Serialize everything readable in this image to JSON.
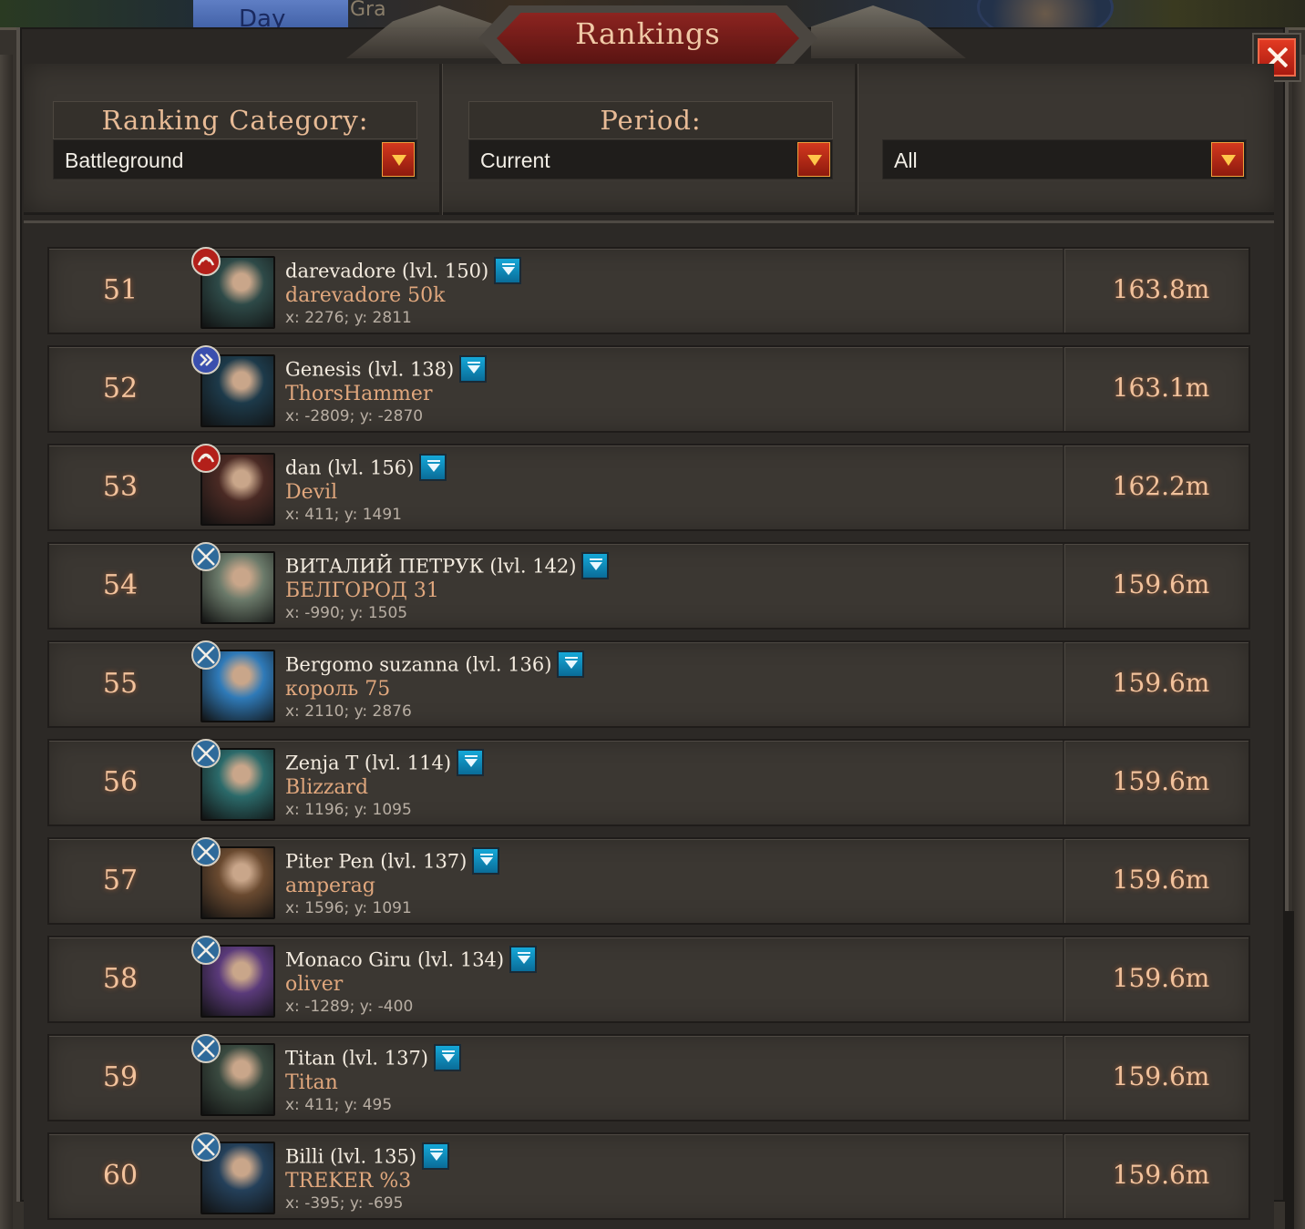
{
  "top_strip": {
    "day_label": "Day",
    "partial_label": "Gra"
  },
  "window": {
    "title": "Rankings",
    "close_icon": "close-icon"
  },
  "filters": {
    "category": {
      "label": "Ranking  Category:",
      "value": "Battleground"
    },
    "period": {
      "label": "Period:",
      "value": "Current"
    },
    "scope": {
      "label": "",
      "value": "All"
    }
  },
  "rows": [
    {
      "rank": "51",
      "name": "darevadore (lvl. 150)",
      "alliance": "darevadore 50k",
      "coords": "x: 2276; y: 2811",
      "score": "163.8m",
      "badge": "dragon-badge-icon",
      "badge_color": "#b3201a",
      "avatar_color": "#2e4a48"
    },
    {
      "rank": "52",
      "name": "Genesis (lvl. 138)",
      "alliance": "ThorsHammer",
      "coords": "x: -2809; y: -2870",
      "score": "163.1m",
      "badge": "shield-rune-badge-icon",
      "badge_color": "#3a4fae",
      "avatar_color": "#1d3a4a"
    },
    {
      "rank": "53",
      "name": "dan (lvl. 156)",
      "alliance": "Devil",
      "coords": "x: 411; y: 1491",
      "score": "162.2m",
      "badge": "dragon-badge-icon",
      "badge_color": "#b3201a",
      "avatar_color": "#4a2a24"
    },
    {
      "rank": "54",
      "name": "ВИТАЛИЙ ПЕТРУК (lvl. 142)",
      "alliance": "БЕЛГОРОД 31",
      "coords": "x: -990; y: 1505",
      "score": "159.6m",
      "badge": "crossed-swords-badge-icon",
      "badge_color": "#2f6a9a",
      "avatar_color": "#6b7a6a"
    },
    {
      "rank": "55",
      "name": "Bergomo suzanna (lvl. 136)",
      "alliance": "король 75",
      "coords": "x: 2110; y: 2876",
      "score": "159.6m",
      "badge": "crossed-swords-badge-icon",
      "badge_color": "#2f6a9a",
      "avatar_color": "#2f7ab8"
    },
    {
      "rank": "56",
      "name": "Zenja T (lvl. 114)",
      "alliance": "Blizzard",
      "coords": "x: 1196; y: 1095",
      "score": "159.6m",
      "badge": "crossed-swords-badge-icon",
      "badge_color": "#2f6a9a",
      "avatar_color": "#2b6a6a"
    },
    {
      "rank": "57",
      "name": "Piter Pen (lvl. 137)",
      "alliance": "amperag",
      "coords": "x: 1596; y: 1091",
      "score": "159.6m",
      "badge": "crossed-swords-badge-icon",
      "badge_color": "#2f6a9a",
      "avatar_color": "#6a4a30"
    },
    {
      "rank": "58",
      "name": "Monaco Giru (lvl. 134)",
      "alliance": "oliver",
      "coords": "x: -1289; y: -400",
      "score": "159.6m",
      "badge": "crossed-swords-badge-icon",
      "badge_color": "#2f6a9a",
      "avatar_color": "#5a3a7a"
    },
    {
      "rank": "59",
      "name": "Titan (lvl. 137)",
      "alliance": "Titan",
      "coords": "x: 411; y: 495",
      "score": "159.6m",
      "badge": "crossed-swords-badge-icon",
      "badge_color": "#2f6a9a",
      "avatar_color": "#3a4a40"
    },
    {
      "rank": "60",
      "name": "Billi (lvl. 135)",
      "alliance": "TREKER %3",
      "coords": "x: -395; y: -695",
      "score": "159.6m",
      "badge": "crossed-swords-badge-icon",
      "badge_color": "#2f6a9a",
      "avatar_color": "#24405a"
    }
  ]
}
